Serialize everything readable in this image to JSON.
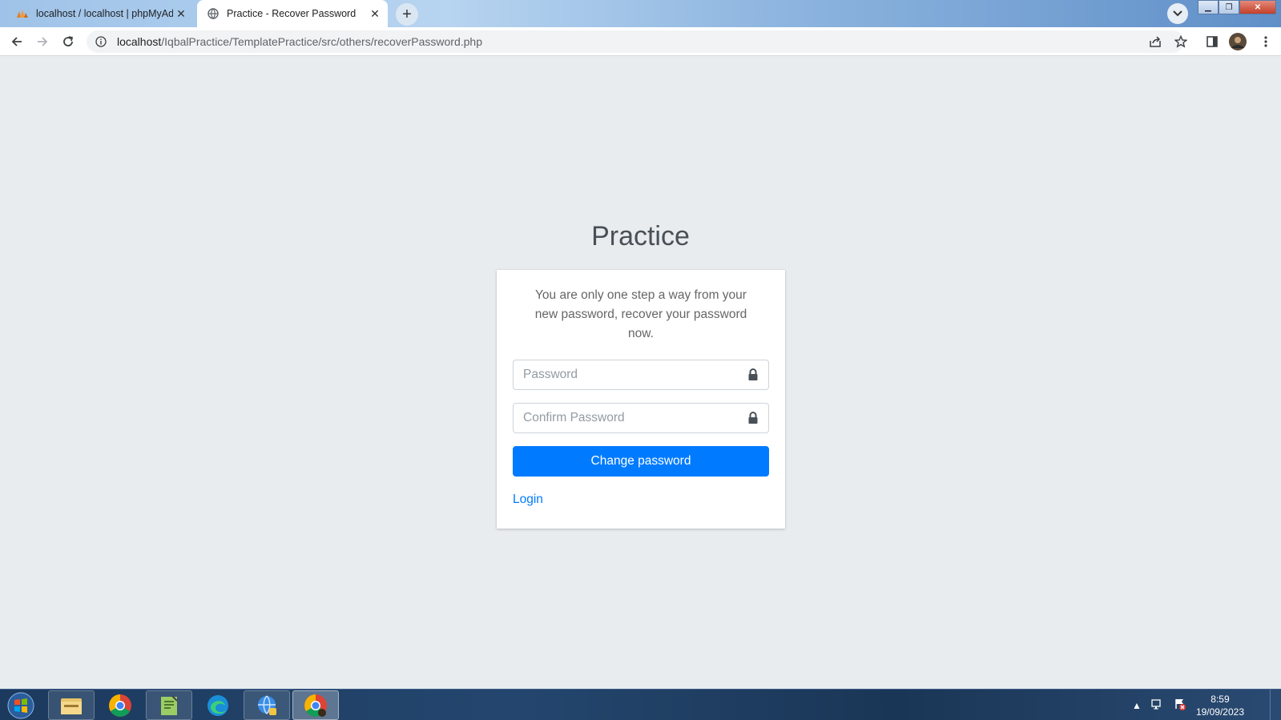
{
  "browser": {
    "tabs": [
      {
        "title": "localhost / localhost | phpMyAdm",
        "icon": "phpmyadmin-icon",
        "active": false
      },
      {
        "title": "Practice - Recover Password",
        "icon": "globe-icon",
        "active": true
      }
    ],
    "url_host": "localhost",
    "url_path": "/IqbalPractice/TemplatePractice/src/others/recoverPassword.php"
  },
  "page": {
    "brand": "Practice",
    "message": "You are only one step a way from your new password, recover your password now.",
    "password_placeholder": "Password",
    "confirm_placeholder": "Confirm Password",
    "submit_label": "Change password",
    "login_link": "Login"
  },
  "taskbar": {
    "apps": [
      "file-explorer",
      "chrome",
      "notepad-plus-plus",
      "edge",
      "network-app",
      "chrome-active"
    ],
    "time": "8:59",
    "date": "19/09/2023"
  },
  "colors": {
    "primary": "#007bff",
    "page_bg": "#e9ecef"
  }
}
